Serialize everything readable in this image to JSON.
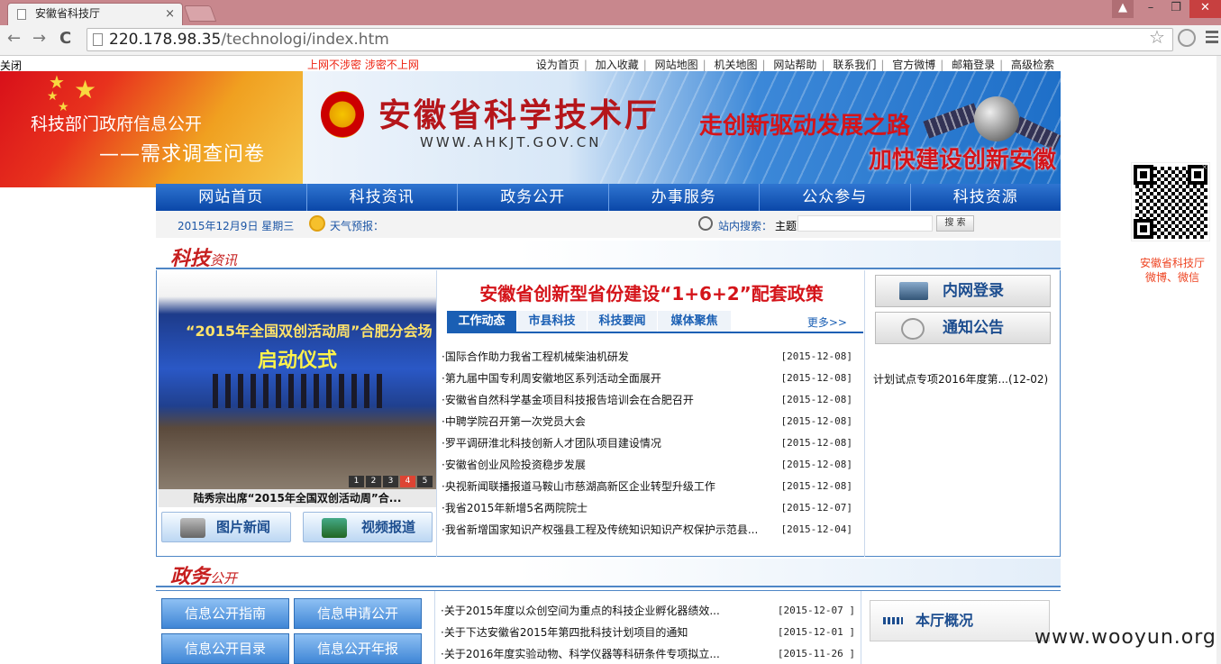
{
  "browser": {
    "tab_title": "安徽省科技厅",
    "tab_close": "×",
    "url_host": "220.178.98.35",
    "url_path": "/technologi/index.htm",
    "nav_back": "←",
    "nav_forward": "→",
    "nav_reload": "C",
    "star": "☆",
    "win_min": "–",
    "win_max": "❐",
    "win_close": "✕",
    "win_user": "▲"
  },
  "page": {
    "close_link": "关闭",
    "slogan": "上网不涉密  涉密不上网",
    "top_links": [
      "设为首页",
      "加入收藏",
      "网站地图",
      "机关地图",
      "网站帮助",
      "联系我们",
      "官方微博",
      "邮箱登录",
      "高级检索"
    ],
    "survey": {
      "line1": "科技部门政府信息公开",
      "line2": "——需求调查问卷"
    },
    "banner": {
      "title": "安徽省科学技术厅",
      "url": "WWW.AHKJT.GOV.CN",
      "slogan1": "走创新驱动发展之路",
      "slogan2": "加快建设创新安徽"
    },
    "nav": [
      "网站首页",
      "科技资讯",
      "政务公开",
      "办事服务",
      "公众参与",
      "科技资源"
    ],
    "date": "2015年12月9日  星期三",
    "weather": "天气预报：",
    "search": {
      "label": "站内搜索：",
      "scope": "主题",
      "button": "搜 索",
      "value": ""
    },
    "tech_section": {
      "title_big": "科技",
      "title_small": "资讯"
    },
    "photo": {
      "banner_text": "“2015年全国双创活动周”合肥分会场",
      "launch_text": "启动仪式",
      "caption": "陆秀宗出席“2015年全国双创活动周”合...",
      "pager": [
        "1",
        "2",
        "3",
        "4",
        "5"
      ]
    },
    "photo_buttons": {
      "pic": "图片新闻",
      "video": "视频报道"
    },
    "headline": "安徽省创新型省份建设“1+6+2”配套政策",
    "news_tabs": [
      "工作动态",
      "市县科技",
      "科技要闻",
      "媒体聚焦"
    ],
    "more": "更多>>",
    "news": [
      {
        "title": "·国际合作助力我省工程机械柴油机研发",
        "date": "[2015-12-08]"
      },
      {
        "title": "·第九届中国专利周安徽地区系列活动全面展开",
        "date": "[2015-12-08]"
      },
      {
        "title": "·安徽省自然科学基金项目科技报告培训会在合肥召开",
        "date": "[2015-12-08]"
      },
      {
        "title": "·中聘学院召开第一次党员大会",
        "date": "[2015-12-08]"
      },
      {
        "title": "·罗平调研淮北科技创新人才团队项目建设情况",
        "date": "[2015-12-08]"
      },
      {
        "title": "·安徽省创业风险投资稳步发展",
        "date": "[2015-12-08]"
      },
      {
        "title": "·央视新闻联播报道马鞍山市慈湖高新区企业转型升级工作",
        "date": "[2015-12-08]"
      },
      {
        "title": "·我省2015年新增5名两院院士",
        "date": "[2015-12-07]"
      },
      {
        "title": "·我省新增国家知识产权强县工程及传统知识知识产权保护示范县...",
        "date": "[2015-12-04]"
      }
    ],
    "side_buttons": {
      "intranet": "内网登录",
      "notice": "通知公告"
    },
    "notice_item": "计划试点专项2016年度第...(12-02)",
    "gov_section": {
      "title_big": "政务",
      "title_small": "公开"
    },
    "gov_buttons": [
      "信息公开指南",
      "信息申请公开",
      "信息公开目录",
      "信息公开年报"
    ],
    "gov_news": [
      {
        "title": "·关于2015年度以众创空间为重点的科技企业孵化器绩效...",
        "date": "[2015-12-07 ]"
      },
      {
        "title": "·关于下达安徽省2015年第四批科技计划项目的通知",
        "date": "[2015-12-01 ]"
      },
      {
        "title": "·关于2016年度实验动物、科学仪器等科研条件专项拟立...",
        "date": "[2015-11-26 ]"
      }
    ],
    "overview_button": "本厅概况",
    "qr_caption1": "安徽省科技厅",
    "qr_caption2": "微博、微信",
    "qr_close": "×",
    "watermark": "www.wooyun.org"
  }
}
